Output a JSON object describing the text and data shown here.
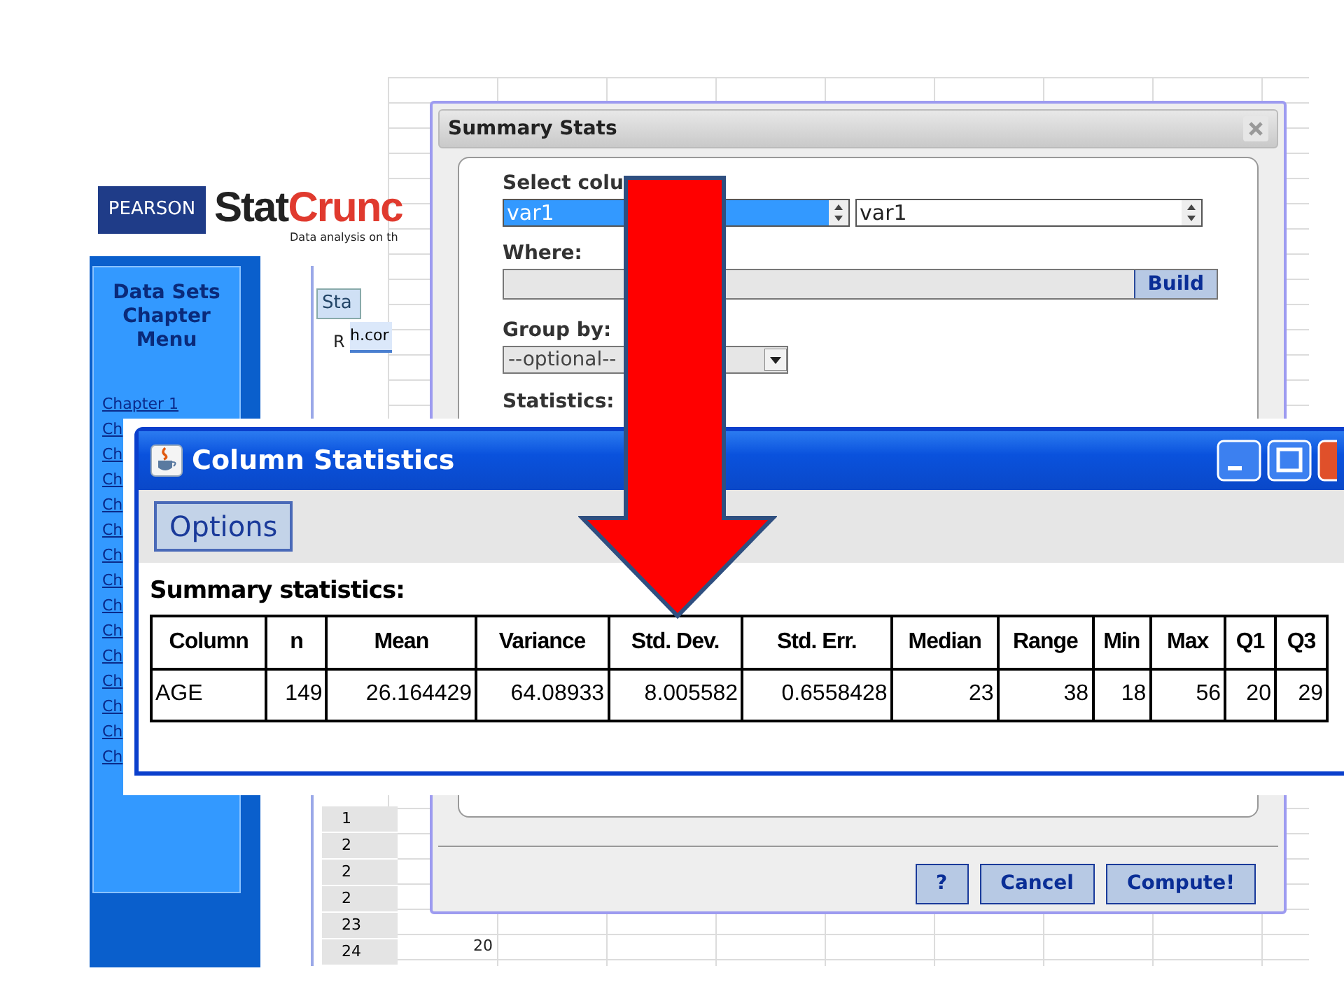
{
  "statcrunch": {
    "logo_badge": "PEARSON",
    "logo_stat": "Stat",
    "logo_crunch": "Crunc",
    "tagline": "Data analysis on th",
    "sidebar_title": "Data Sets Chapter Menu",
    "links": [
      "Chapter 1",
      "Ch",
      "Ch",
      "Ch",
      "Ch",
      "Ch",
      "Ch",
      "Ch",
      "Ch",
      "Ch",
      "Ch",
      "Ch",
      "Ch",
      "Ch",
      "Ch"
    ]
  },
  "spreadsheet": {
    "tab": "Sta",
    "header_fragments": [
      "R",
      "h.cor"
    ],
    "row_numbers": [
      "1",
      "2",
      "2",
      "2",
      "23",
      "24"
    ],
    "cell": "20"
  },
  "summary_stats": {
    "title": "Summary Stats",
    "select_label": "Select colu",
    "selects": [
      {
        "value": "var1",
        "selected": true
      },
      {
        "value": "var1",
        "selected": false
      }
    ],
    "where_label": "Where:",
    "build": "Build",
    "group_label": "Group by:",
    "group_placeholder": "--optional--",
    "statistics_label": "Statistics:",
    "buttons": [
      "?",
      "Cancel",
      "Compute!"
    ]
  },
  "column_statistics": {
    "title": "Column Statistics",
    "options": "Options",
    "heading": "Summary statistics:",
    "columns": [
      "Column",
      "n",
      "Mean",
      "Variance",
      "Std. Dev.",
      "Std. Err.",
      "Median",
      "Range",
      "Min",
      "Max",
      "Q1",
      "Q3"
    ],
    "rows": [
      [
        "AGE",
        "149",
        "26.164429",
        "64.08933",
        "8.005582",
        "0.6558428",
        "23",
        "38",
        "18",
        "56",
        "20",
        "29"
      ]
    ]
  }
}
